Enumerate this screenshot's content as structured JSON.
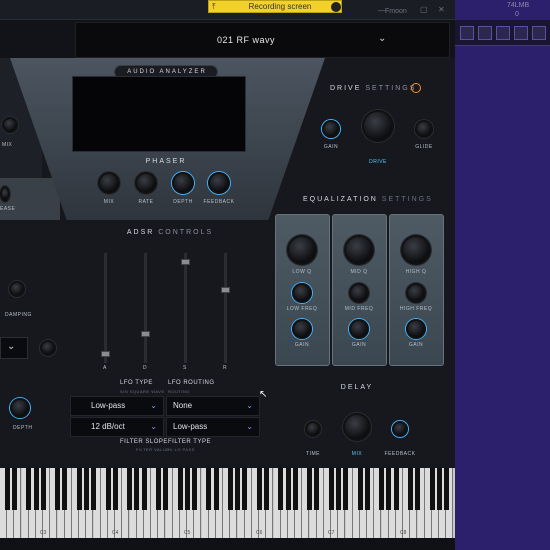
{
  "recording": {
    "label": "Recording screen",
    "icon": "upload-icon"
  },
  "daw": {
    "readout_1": "74LMB",
    "readout_2": "0",
    "track": "Fmoon"
  },
  "preset": {
    "name": "021 RF wavy"
  },
  "analyzer": {
    "title": "AUDIO ANALYZER"
  },
  "left_labels": {
    "mix": "MIX",
    "release": "EASE",
    "damping": "DAMPING",
    "depth": "DEPTH"
  },
  "phaser": {
    "title": "PHASER",
    "knobs": [
      "MIX",
      "RATE",
      "DEPTH",
      "FEEDBACK"
    ]
  },
  "drive": {
    "title_a": "DRIVE",
    "title_b": "SETTINGS",
    "gain": "GAIN",
    "drive": "DRIVE",
    "glide": "GLIDE"
  },
  "adsr": {
    "title_a": "ADSR",
    "title_b": "CONTROLS",
    "letters": [
      "A",
      "D",
      "S",
      "R"
    ]
  },
  "eq": {
    "title_a": "EQUALIZATION",
    "title_b": "SETTINGS",
    "bands": [
      {
        "q": "LOW Q",
        "freq": "LOW FREQ",
        "gain": "GAIN"
      },
      {
        "q": "MID Q",
        "freq": "MID FREQ",
        "gain": "GAIN"
      },
      {
        "q": "HIGH Q",
        "freq": "HIGH FREQ",
        "gain": "GAIN"
      }
    ]
  },
  "lfo": {
    "type_label": "LFO TYPE",
    "type_sub": "SIN SQUARE WAVE",
    "routing_label": "LFO ROUTING",
    "routing_sub": "ROUTING",
    "filter_slope_label": "FILTER SLOPE",
    "filter_slope_sub": "FILTER VALUE",
    "filter_type_label": "FILTER TYPE",
    "filter_type_sub": "HI LO PASS",
    "lfo_type_value": "Low-pass",
    "routing_value": "None",
    "slope_value": "12 dB/oct",
    "filter_type_value": "Low-pass"
  },
  "delay": {
    "title": "DELAY",
    "time": "TIME",
    "mix": "MIX",
    "feedback": "FEEDBACK"
  },
  "keyboard": {
    "notes": [
      "C3",
      "C4",
      "C5",
      "C6",
      "C7",
      "C8"
    ]
  },
  "colors": {
    "accent": "#42b5ff",
    "recording": "#f2d12b",
    "daw_panel": "#2c1f6b"
  }
}
